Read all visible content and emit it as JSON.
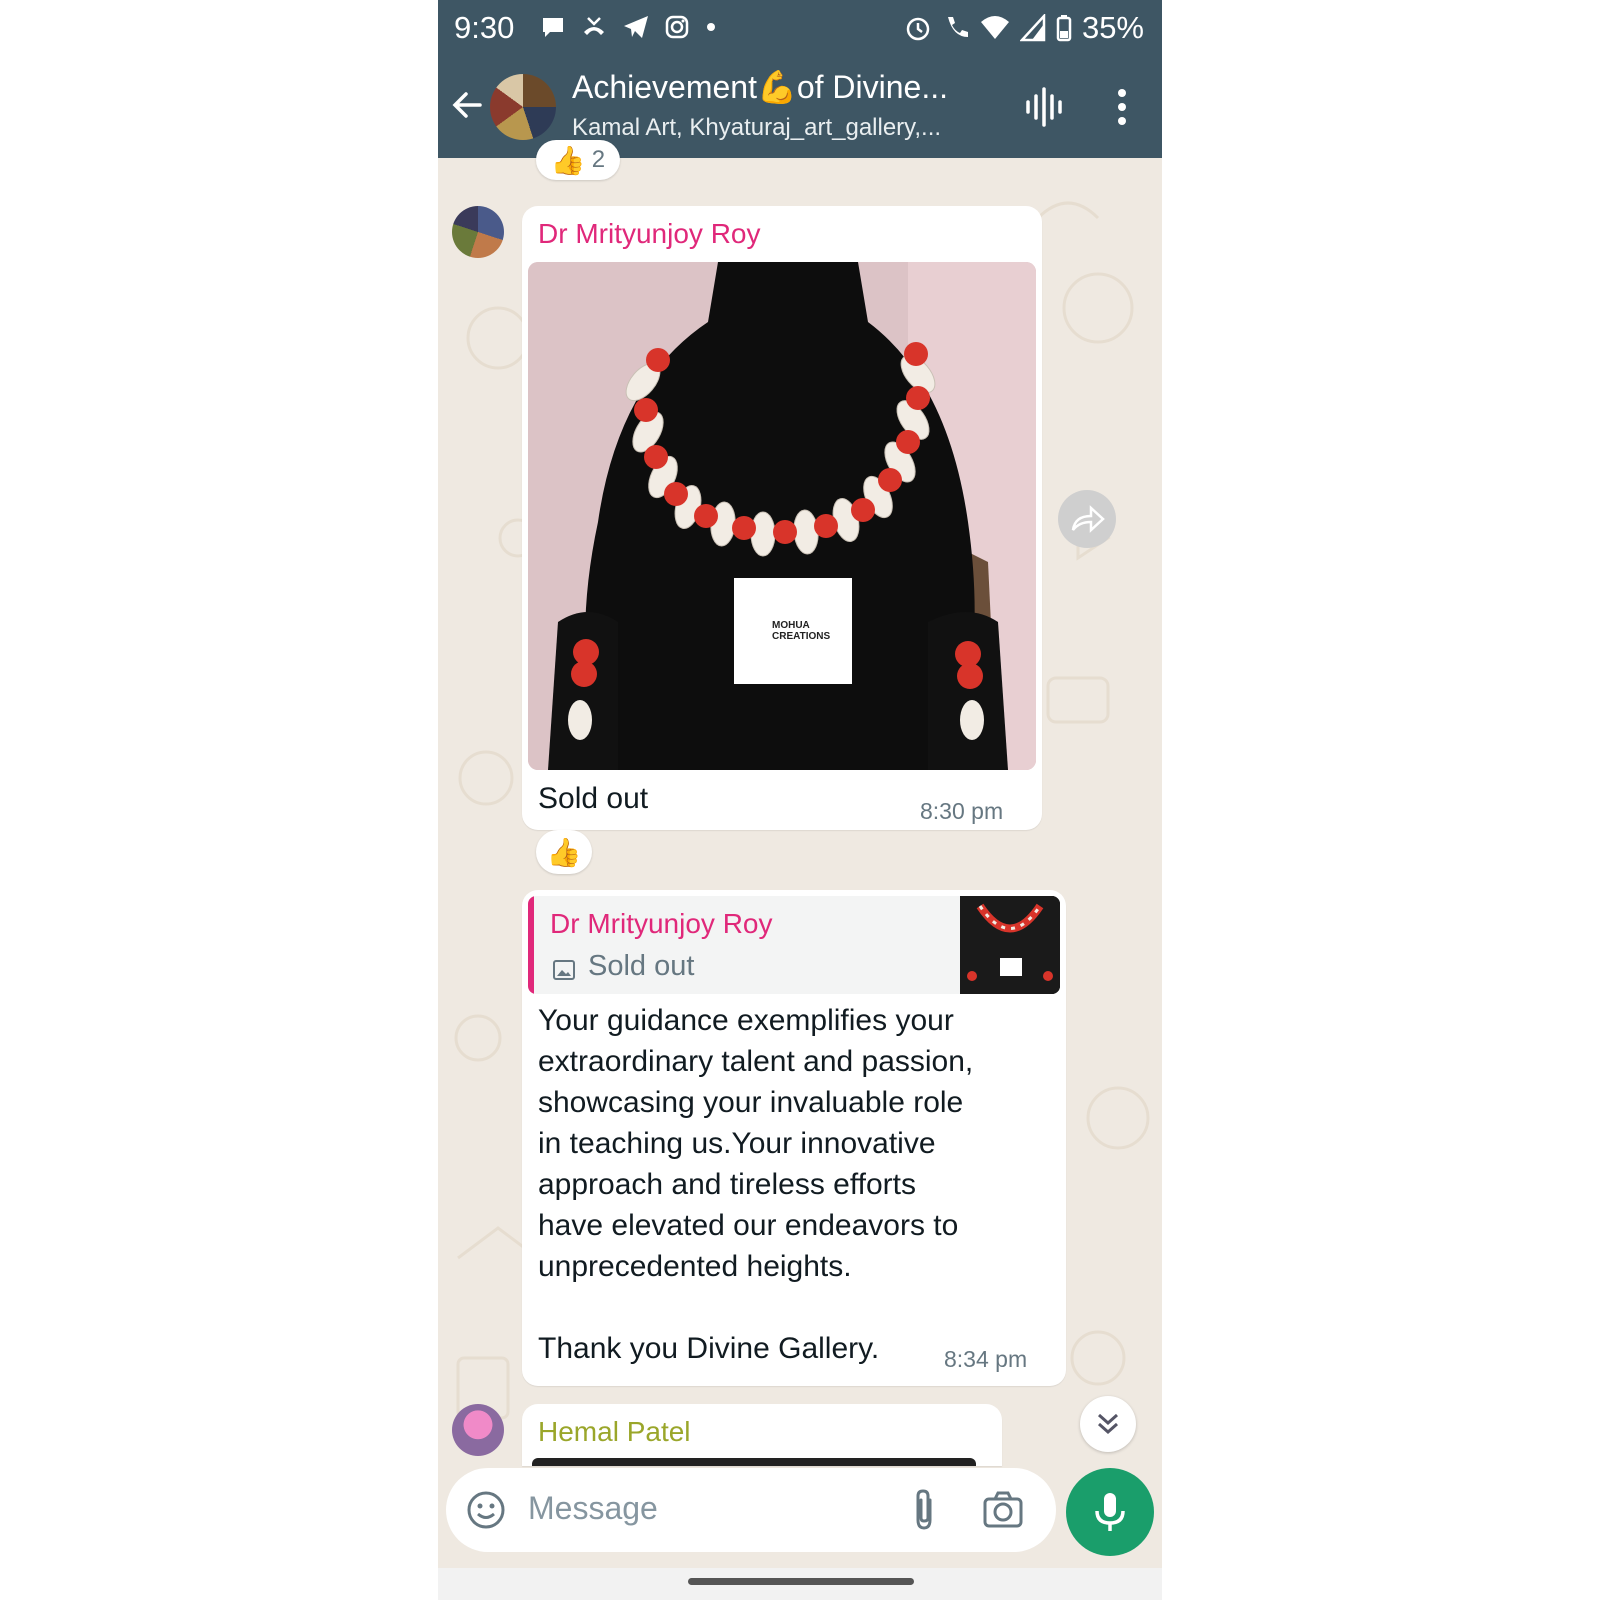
{
  "status_bar": {
    "time": "9:30",
    "battery": "35%",
    "left_icons": [
      "chat-bubble-icon",
      "missed-call-icon",
      "telegram-icon",
      "instagram-icon",
      "dot-icon"
    ],
    "right_icons": [
      "alarm-icon",
      "wifi-call-icon",
      "wifi-icon",
      "signal-icon",
      "battery-icon"
    ]
  },
  "header": {
    "title": "Achievement💪of Divine...",
    "subtitle": "Kamal Art, Khyaturaj_art_gallery,...",
    "icons": [
      "back-arrow-icon",
      "group-avatar",
      "voice-chat-icon",
      "more-vert-icon"
    ]
  },
  "top_reaction": {
    "emoji": "👍",
    "count": "2"
  },
  "messages": [
    {
      "sender": "Dr Mrityunjoy Roy",
      "sender_color": "#e0287a",
      "image_label": "MOHUA CREATIONS",
      "caption": "Sold out",
      "time": "8:30 pm",
      "reaction": "👍"
    },
    {
      "quote_sender": "Dr Mrityunjoy Roy",
      "quote_text": "Sold out",
      "text": "Your guidance exemplifies your\nextraordinary talent and passion,\nshowcasing your invaluable role\nin teaching us.Your innovative\napproach and tireless efforts\nhave elevated our endeavors to\nunprecedented heights.\n\nThank you Divine Gallery.",
      "time": "8:34 pm"
    },
    {
      "sender": "Hemal Patel",
      "sender_color": "#9aa62a"
    }
  ],
  "composer": {
    "placeholder": "Message",
    "icons": [
      "emoji-icon",
      "attach-icon",
      "camera-icon",
      "mic-icon"
    ]
  },
  "colors": {
    "header_bg": "#3e5664",
    "chat_bg": "#efe9e1",
    "accent_green": "#1a9e6b"
  }
}
